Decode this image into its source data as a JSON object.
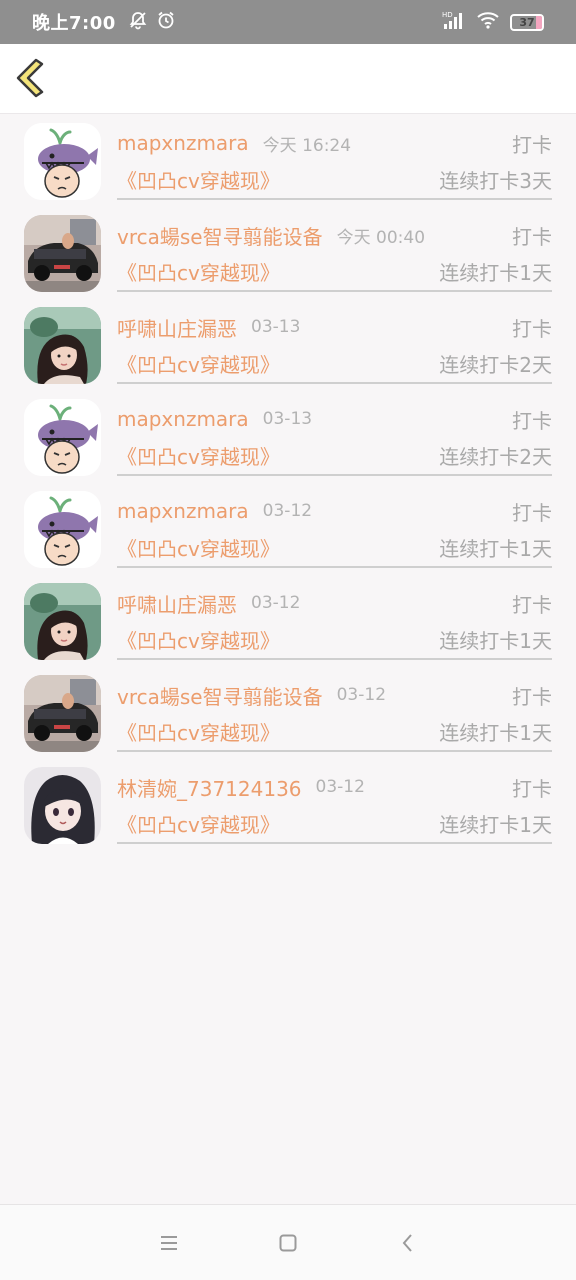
{
  "status_bar": {
    "time": "晚上7:00",
    "icons": [
      "notifications-off-icon",
      "alarm-icon",
      "hd-signal-icon",
      "wifi-icon",
      "battery-icon"
    ],
    "battery_level": "37",
    "signal_badge": "HD"
  },
  "header": {
    "back_icon": "chevron-left-icon"
  },
  "colors": {
    "accent": "#ec9d6d",
    "muted": "#a9a9a9",
    "back_icon_fill": "#f4e47a",
    "back_icon_stroke": "#3a3a3a"
  },
  "checkins": [
    {
      "user": "mapxnzmara",
      "time": "今天 16:24",
      "action": "打卡",
      "book": "《凹凸cv穿越现》",
      "streak": "连续打卡3天",
      "avatar": "whale-cartoon"
    },
    {
      "user": "vrca蝪se智寻翦能设备",
      "time": "今天 00:40",
      "action": "打卡",
      "book": "《凹凸cv穿越现》",
      "streak": "连续打卡1天",
      "avatar": "car-photo"
    },
    {
      "user": "呼啸山庄漏恶",
      "time": "03-13",
      "action": "打卡",
      "book": "《凹凸cv穿越现》",
      "streak": "连续打卡2天",
      "avatar": "girl-photo"
    },
    {
      "user": "mapxnzmara",
      "time": "03-13",
      "action": "打卡",
      "book": "《凹凸cv穿越现》",
      "streak": "连续打卡2天",
      "avatar": "whale-cartoon"
    },
    {
      "user": "mapxnzmara",
      "time": "03-12",
      "action": "打卡",
      "book": "《凹凸cv穿越现》",
      "streak": "连续打卡1天",
      "avatar": "whale-cartoon"
    },
    {
      "user": "呼啸山庄漏恶",
      "time": "03-12",
      "action": "打卡",
      "book": "《凹凸cv穿越现》",
      "streak": "连续打卡1天",
      "avatar": "girl-photo"
    },
    {
      "user": "vrca蝪se智寻翦能设备",
      "time": "03-12",
      "action": "打卡",
      "book": "《凹凸cv穿越现》",
      "streak": "连续打卡1天",
      "avatar": "car-photo"
    },
    {
      "user": "林清婉_737124136",
      "time": "03-12",
      "action": "打卡",
      "book": "《凹凸cv穿越现》",
      "streak": "连续打卡1天",
      "avatar": "anime-girl"
    }
  ],
  "nav_bar": {
    "icons": [
      "menu-icon",
      "home-icon",
      "back-icon"
    ]
  }
}
